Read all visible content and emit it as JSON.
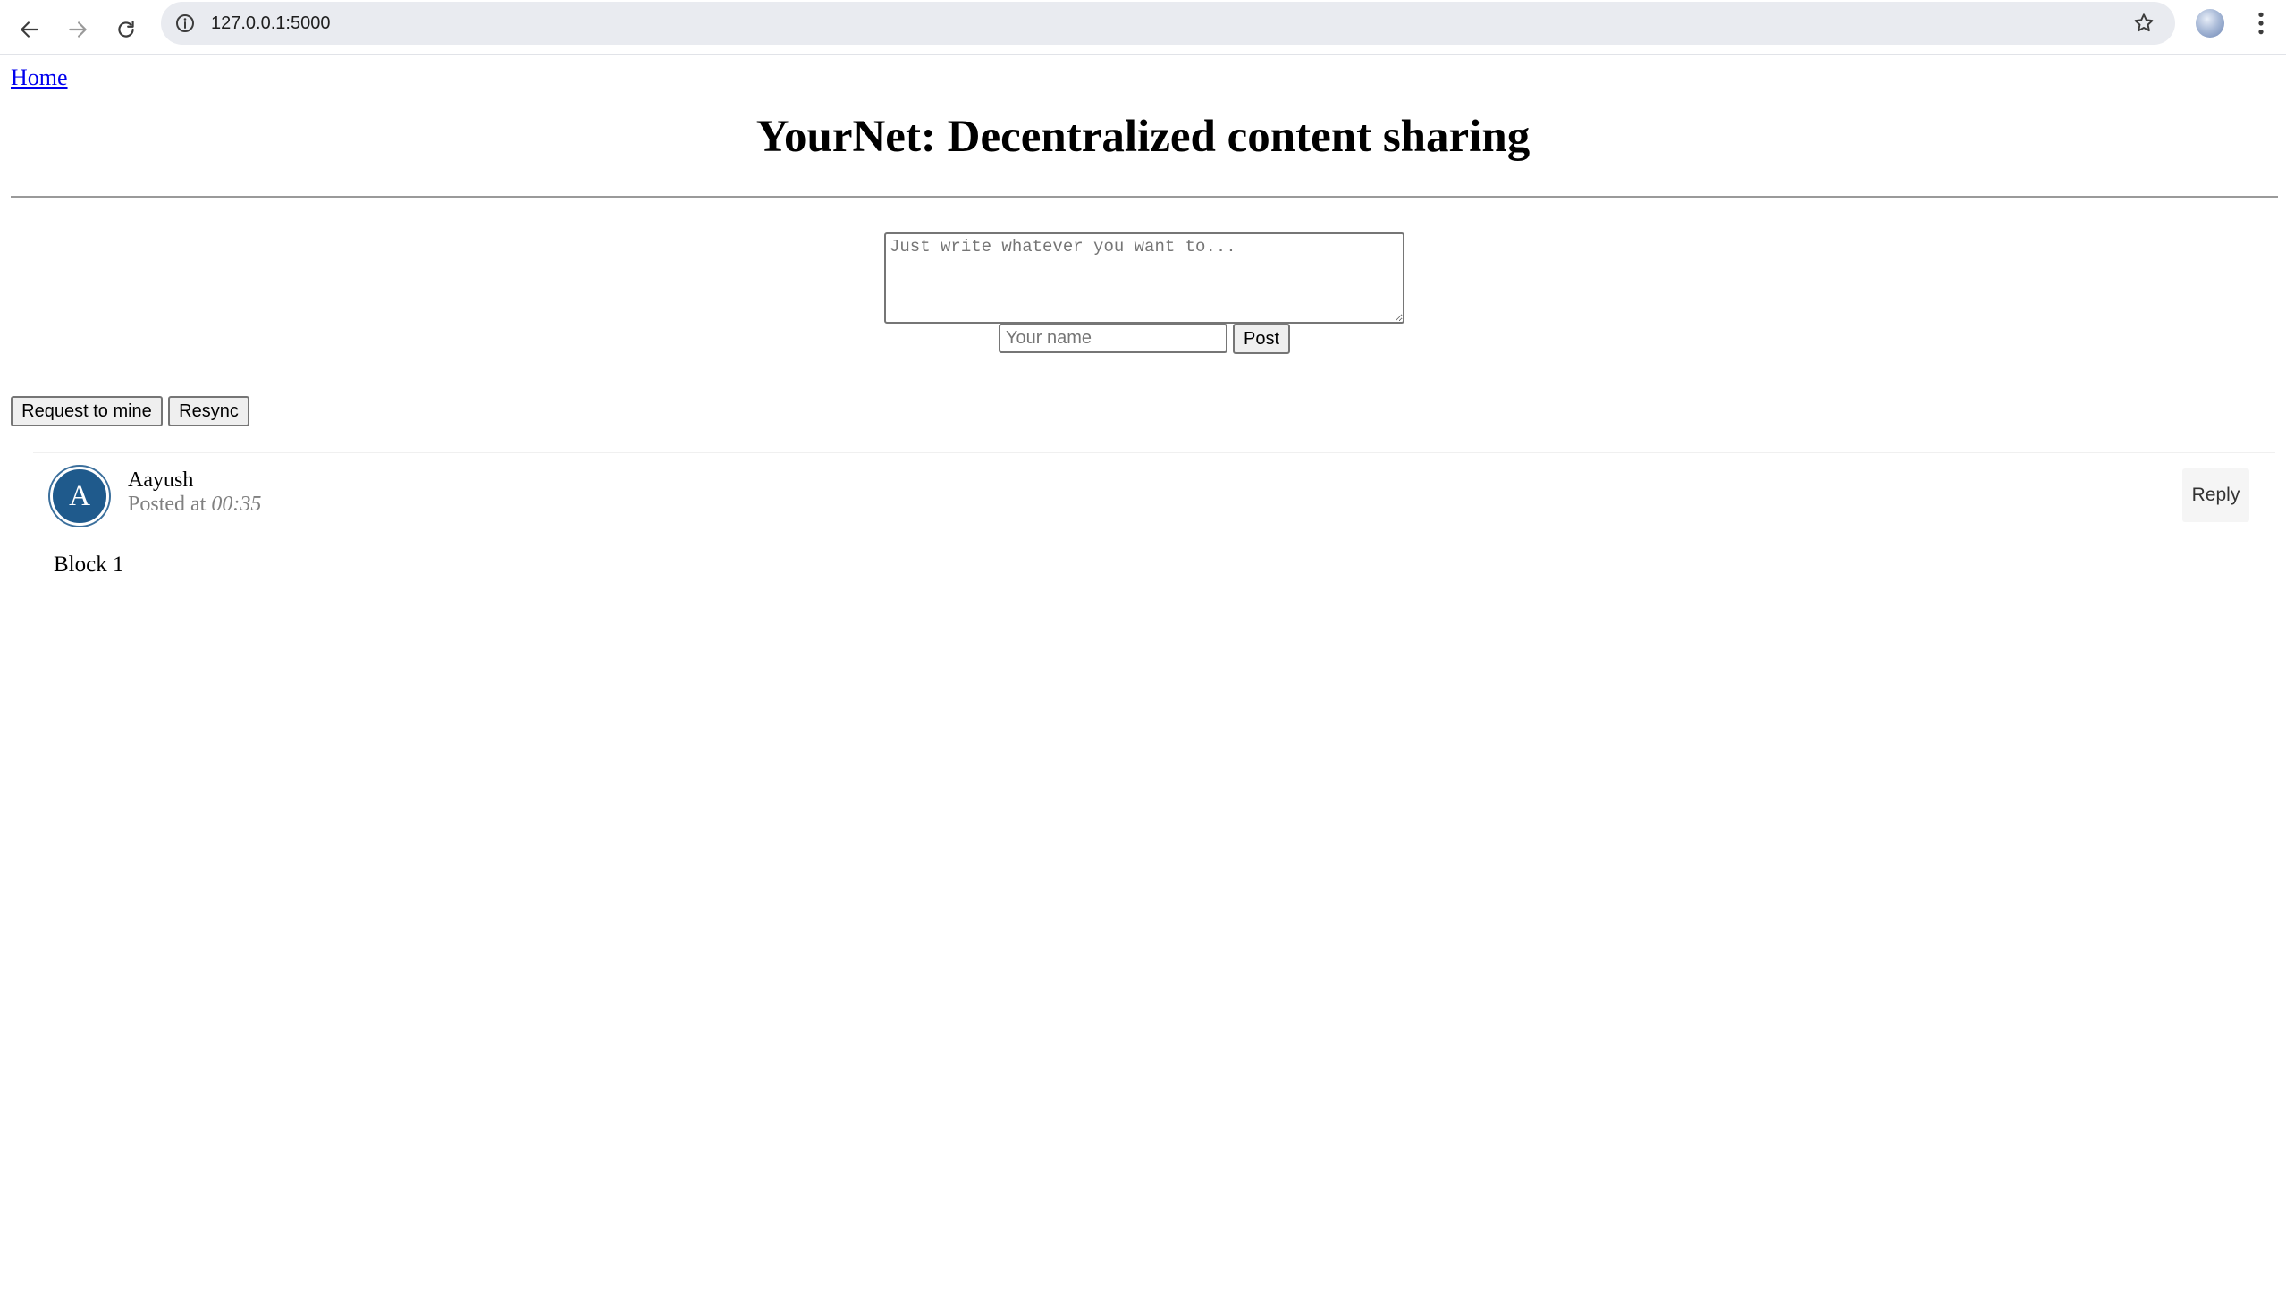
{
  "browser": {
    "url": "127.0.0.1:5000"
  },
  "nav": {
    "home_label": "Home"
  },
  "header": {
    "title": "YourNet: Decentralized content sharing"
  },
  "composer": {
    "text_placeholder": "Just write whatever you want to...",
    "text_value": "",
    "name_placeholder": "Your name",
    "name_value": "",
    "post_label": "Post"
  },
  "actions": {
    "request_mine_label": "Request to mine",
    "resync_label": "Resync"
  },
  "posts": [
    {
      "avatar_letter": "A",
      "author": "Aayush",
      "posted_at_label": "Posted at",
      "time": "00:35",
      "reply_label": "Reply",
      "body": "Block 1"
    }
  ],
  "colors": {
    "avatar_bg": "#1f5a8c",
    "link": "#0000ee"
  }
}
